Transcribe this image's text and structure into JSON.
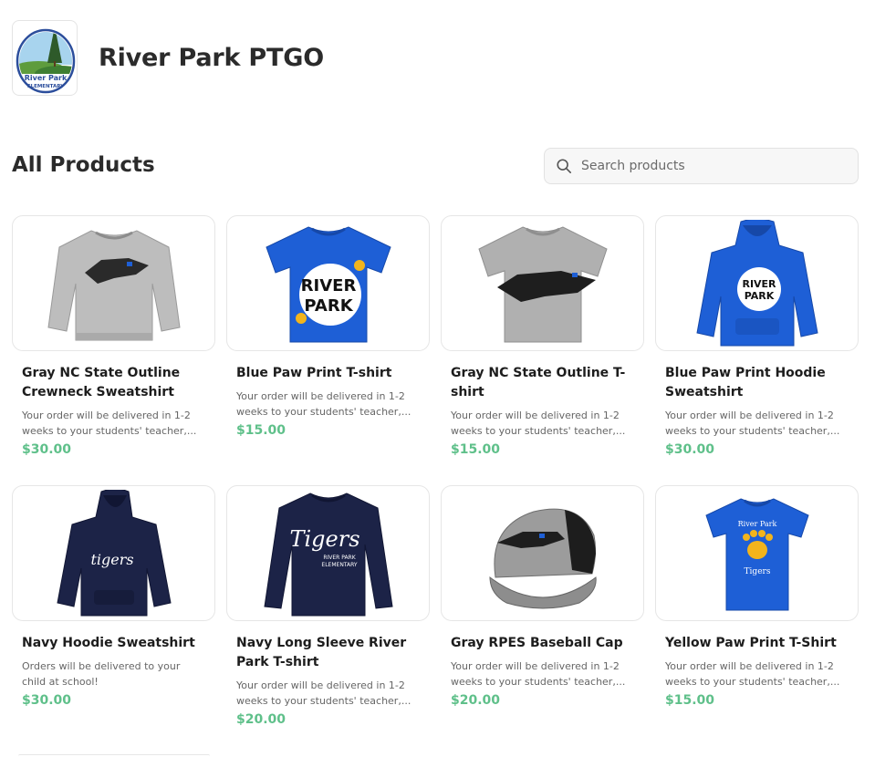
{
  "store": {
    "name": "River Park PTGO",
    "logo_text_1": "River Park",
    "logo_text_2": "ELEMENTARY"
  },
  "section": {
    "title": "All Products"
  },
  "search": {
    "placeholder": "Search products"
  },
  "products": [
    {
      "name": "Gray NC State Outline Crewneck Sweatshirt",
      "description": "Your order will be delivered in 1-2 weeks to your students' teacher,...",
      "price": "$30.00",
      "icon": "gray-sweatshirt"
    },
    {
      "name": "Blue Paw Print T-shirt",
      "description": "Your order will be delivered in 1-2 weeks to your students' teacher,...",
      "price": "$15.00",
      "icon": "blue-tshirt"
    },
    {
      "name": "Gray NC State Outline T-shirt",
      "description": "Your order will be delivered in 1-2 weeks to your students' teacher,...",
      "price": "$15.00",
      "icon": "gray-tshirt"
    },
    {
      "name": "Blue Paw Print Hoodie Sweatshirt",
      "description": "Your order will be delivered in 1-2 weeks to your students' teacher,...",
      "price": "$30.00",
      "icon": "blue-hoodie"
    },
    {
      "name": "Navy Hoodie Sweatshirt",
      "description": "Orders will be delivered to your child at school!",
      "price": "$30.00",
      "icon": "navy-hoodie"
    },
    {
      "name": "Navy Long Sleeve River Park T-shirt",
      "description": "Your order will be delivered in 1-2 weeks to your students' teacher,...",
      "price": "$20.00",
      "icon": "navy-longsleeve"
    },
    {
      "name": "Gray RPES Baseball Cap",
      "description": "Your order will be delivered in 1-2 weeks to your students' teacher,...",
      "price": "$20.00",
      "icon": "gray-cap"
    },
    {
      "name": "Yellow Paw Print T-Shirt",
      "description": "Your order will be delivered in 1-2 weeks to your students' teacher,...",
      "price": "$15.00",
      "icon": "yellow-paw-tshirt"
    }
  ],
  "colors": {
    "price": "#5fc08a",
    "royal_blue": "#1e5fd6",
    "navy": "#1c2347",
    "heather_gray": "#b5b5b5"
  }
}
